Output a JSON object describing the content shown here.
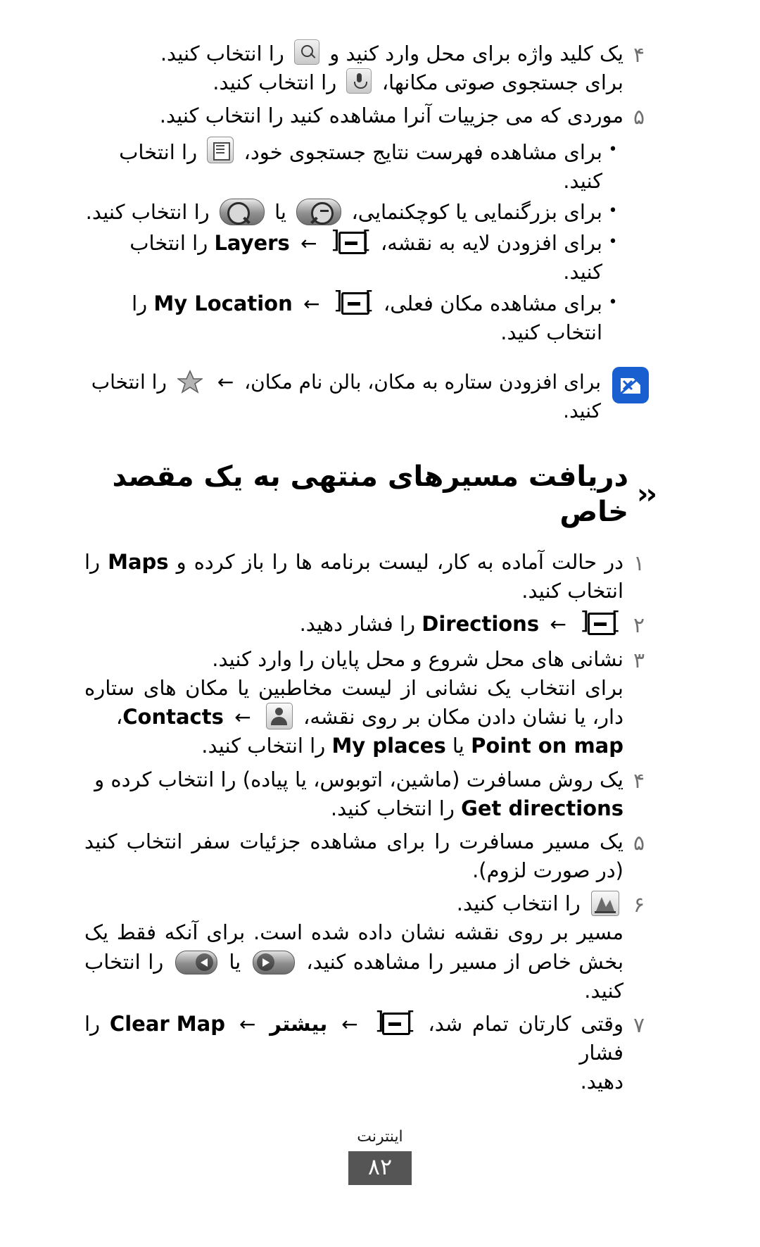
{
  "document": {
    "language": "fa",
    "footer_label": "اینترنت",
    "page_number": "۸۲",
    "page_number_bg": "#555555"
  },
  "steps_top": [
    {
      "number": "۴",
      "lines": [
        "یک کلید واژه برای محل وارد کنید و  [search-icon]  را انتخاب کنید.",
        "برای جستجوی صوتی مکانها، [mic-icon] را انتخاب کنید."
      ],
      "text_a_before": "یک کلید واژه برای محل وارد کنید و",
      "text_a_after": "را انتخاب کنید.",
      "text_b_before": "برای جستجوی صوتی مکانها،",
      "text_b_after": "را انتخاب کنید."
    },
    {
      "number": "۵",
      "text": "موردی که می جزییات آنرا مشاهده کنید را انتخاب کنید."
    }
  ],
  "bullets": [
    {
      "before": "برای مشاهده فهرست نتایج جستجوی خود،",
      "after": "را انتخاب کنید.",
      "icon": "list-view-icon"
    },
    {
      "before": "برای بزرگنمایی یا کوچکنمایی،",
      "middle": "یا",
      "after": "را انتخاب کنید.",
      "icon_a": "zoom-out-icon",
      "icon_b": "zoom-in-icon"
    },
    {
      "before": "برای افزودن لایه به نقشه،",
      "menu_label": "Layers",
      "after": "را انتخاب کنید.",
      "icon": "menu-key-icon"
    },
    {
      "before": "برای مشاهده مکان فعلی،",
      "menu_label": "My Location",
      "after": "را انتخاب کنید.",
      "icon": "menu-key-icon"
    }
  ],
  "note": {
    "icon": "note-pencil-icon",
    "icon_color": "#1a5fd0",
    "before": "برای افزودن ستاره به مکان، بالن نام مکان،",
    "after": "را انتخاب کنید.",
    "icon_inline": "star-icon"
  },
  "section": {
    "chevrons": "‹‹",
    "title": "دریافت مسیرهای منتهی به یک مقصد خاص"
  },
  "steps_main": [
    {
      "number": "۱",
      "before": "در حالت آماده به کار، لیست برنامه ها را باز کرده و",
      "bold": "Maps",
      "after": "را انتخاب کنید."
    },
    {
      "number": "۲",
      "before": "",
      "menu": "menu-key-icon",
      "arrow": "←",
      "bold": "Directions",
      "after": "را فشار دهید."
    },
    {
      "number": "۳",
      "line1": "نشانی های محل شروع و محل پایان را وارد کنید.",
      "line2": "برای انتخاب یک نشانی از لیست مخاطبین یا مکان های ستاره دار، یا نشان دادن مکان بر روی نقشه،",
      "bold1": "Contacts",
      "sep": "،",
      "bold2": "Point on map",
      "or": "یا",
      "bold3": "My places",
      "tail": "را انتخاب کنید."
    },
    {
      "number": "۴",
      "before": "یک روش مسافرت (ماشین، اتوبوس، یا پیاده) را انتخاب کرده و",
      "bold": "Get directions",
      "after": "را انتخاب کنید."
    },
    {
      "number": "۵",
      "text": "یک مسیر مسافرت را برای مشاهده جزئیات سفر انتخاب کنید (در صورت لزوم)."
    },
    {
      "number": "۶",
      "before": "",
      "icon": "route-icon",
      "after": "را انتخاب کنید.",
      "line2": "مسیر بر روی نقشه نشان داده شده است. برای آنکه فقط یک بخش خاص از مسیر را مشاهده کنید،",
      "middle": "یا",
      "tail": "را انتخاب کنید.",
      "icon_a": "next-icon",
      "icon_b": "prev-icon"
    },
    {
      "number": "۷",
      "before": "وقتی کارتان تمام شد،",
      "menu": "menu-key-icon",
      "arrow1": "←",
      "bold1": "بیشتر",
      "arrow2": "←",
      "bold2": "Clear Map",
      "after": "را فشار دهید."
    }
  ]
}
